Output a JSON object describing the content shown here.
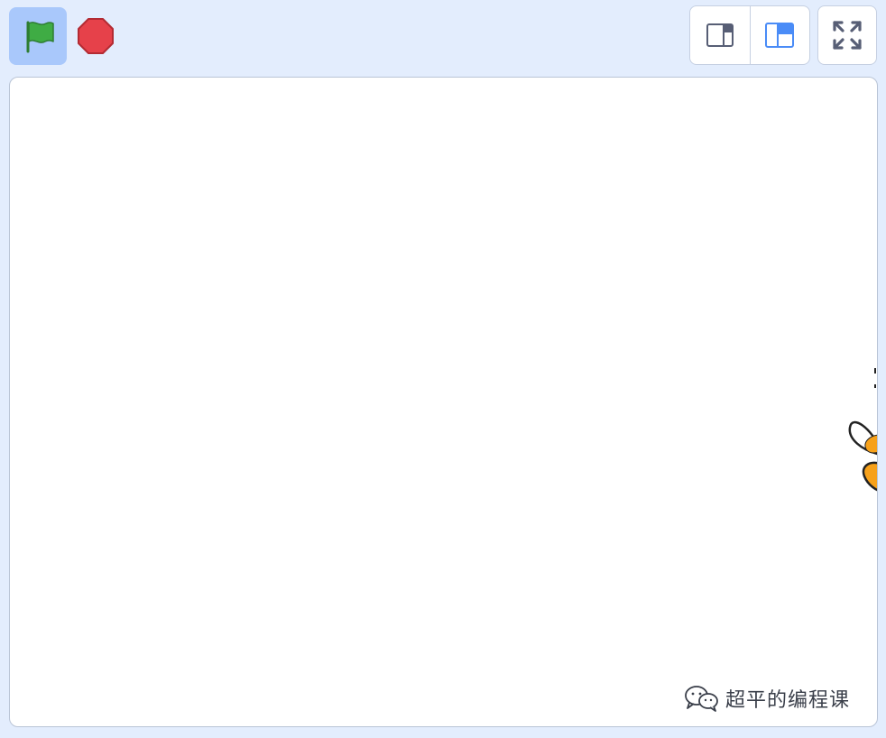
{
  "controls": {
    "green_flag_icon": "green-flag-icon",
    "stop_icon": "stop-sign-icon"
  },
  "layout_modes": [
    {
      "icon": "small-stage-icon",
      "selected": false
    },
    {
      "icon": "normal-stage-icon",
      "selected": true
    }
  ],
  "fullscreen": {
    "icon": "fullscreen-icon"
  },
  "stage": {
    "sprite": "partial-sprite-at-right-edge"
  },
  "watermark": {
    "icon": "wechat-icon",
    "text": "超平的编程课"
  },
  "colors": {
    "background": "#e3edfd",
    "flag_active_bg": "#a9c8fb",
    "flag_green": "#3fac44",
    "stop_red": "#e6414a",
    "mode_selected_blue": "#4a8cf7",
    "sprite_orange": "#f7a11a"
  }
}
